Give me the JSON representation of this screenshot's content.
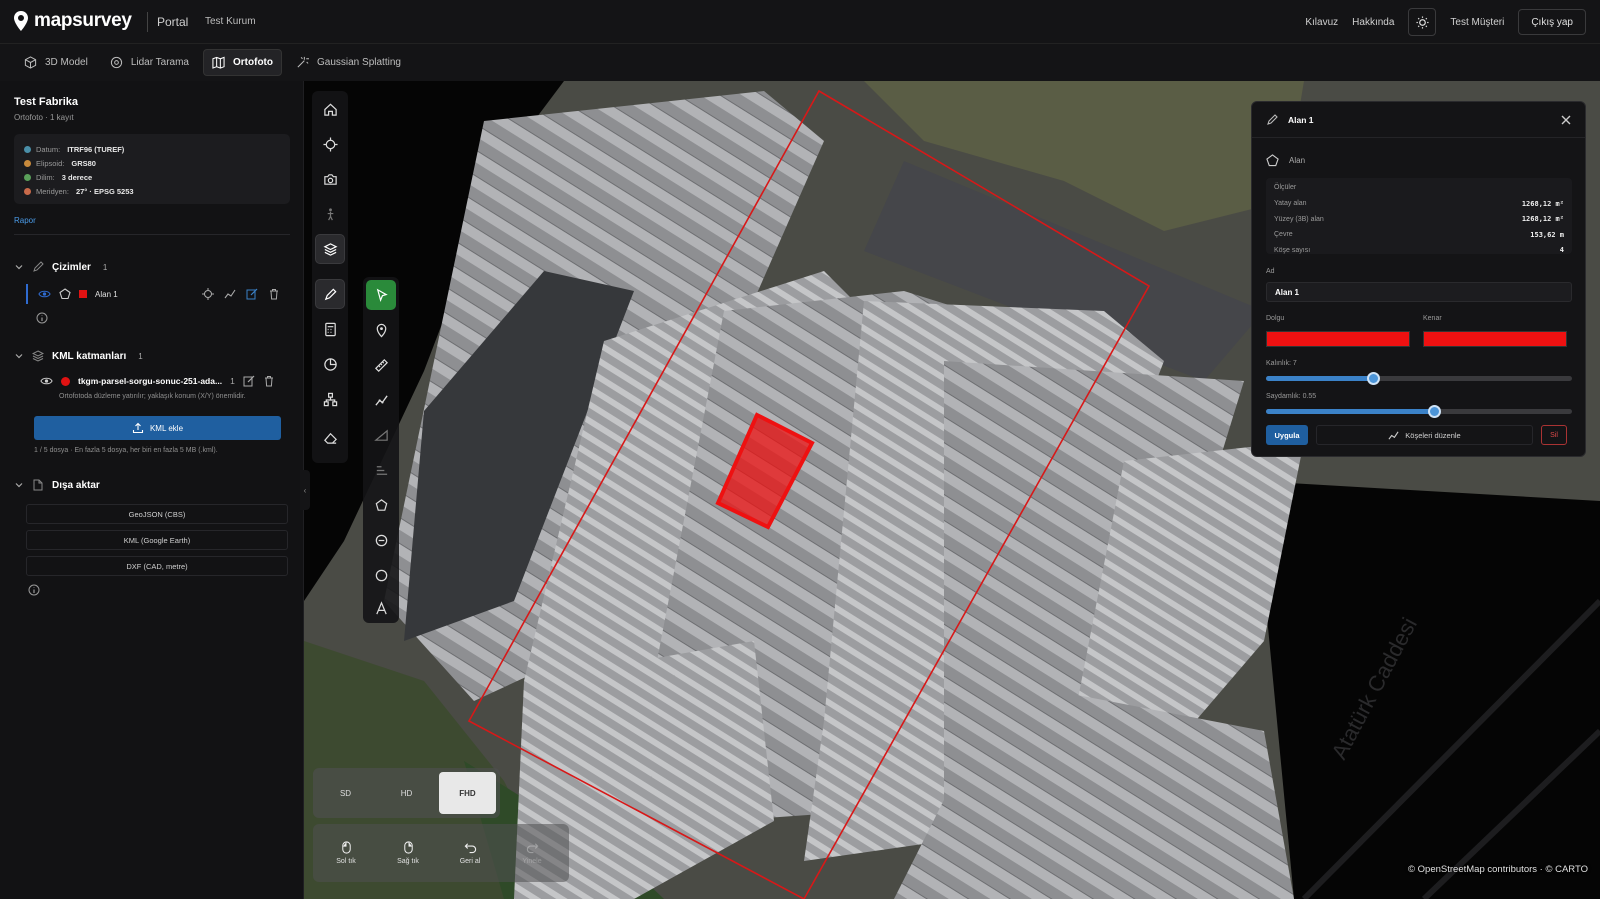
{
  "header": {
    "logo": "mapsurvey",
    "portal": "Portal",
    "organization": "Test Kurum",
    "nav": [
      "Kılavuz",
      "Hakkında"
    ],
    "user": "Test Müşteri",
    "logout": "Çıkış yap"
  },
  "tabs": [
    {
      "label": "3D Model",
      "icon": "cube-icon"
    },
    {
      "label": "Lidar Tarama",
      "icon": "scan-icon"
    },
    {
      "label": "Ortofoto",
      "icon": "map-icon",
      "active": true
    },
    {
      "label": "Gaussian Splatting",
      "icon": "sparkle-icon"
    }
  ],
  "sidebar": {
    "project_title": "Test Fabrika",
    "project_subtitle": "Ortofoto · 1 kayıt",
    "info": [
      {
        "label": "Datum:",
        "value": "ITRF96 (TUREF)"
      },
      {
        "label": "Elipsoid:",
        "value": "GRS80"
      },
      {
        "label": "Dilim:",
        "value": "3 derece"
      },
      {
        "label": "Meridyen:",
        "value": "27° · EPSG 5253"
      }
    ],
    "report_link": "Rapor",
    "drawings": {
      "title": "Çizimler",
      "count": "1",
      "item": "Alan 1"
    },
    "kml": {
      "title": "KML katmanları",
      "count": "1",
      "file": "tkgm-parsel-sorgu-sonuc-251-ada...",
      "file_count": "1",
      "note": "Ortofotoda düzleme yatırılır; yaklaşık konum (X/Y) önemlidir.",
      "add_button": "KML ekle",
      "limit": "1 / 5 dosya · En fazla 5 dosya, her biri en fazla 5 MB (.kml)."
    },
    "export": {
      "title": "Dışa aktar",
      "options": [
        "GeoJSON (CBS)",
        "KML (Google Earth)",
        "DXF (CAD, metre)"
      ]
    }
  },
  "map_controls": {
    "resolutions": [
      "SD",
      "HD",
      "FHD"
    ],
    "active_resolution": "FHD",
    "controls": [
      "Sol tık",
      "Sağ tık",
      "Geri al",
      "Yinele"
    ],
    "attribution": "© OpenStreetMap contributors · © CARTO",
    "street_label": "Atatürk Caddesi"
  },
  "panel": {
    "title": "Alan 1",
    "type": "Alan",
    "measurements_title": "Ölçüler",
    "measurements": [
      {
        "label": "Yatay alan",
        "value": "1268,12 m²"
      },
      {
        "label": "Yüzey (3B) alan",
        "value": "1268,12 m²"
      },
      {
        "label": "Çevre",
        "value": "153,62 m"
      },
      {
        "label": "Köşe sayısı",
        "value": "4"
      }
    ],
    "name_label": "Ad",
    "name_value": "Alan 1",
    "fill_label": "Dolgu",
    "edge_label": "Kenar",
    "fill_color": "#ee1111",
    "edge_color": "#ee1111",
    "thickness_label": "Kalınlık: 7",
    "thickness": 7,
    "opacity_label": "Saydamlık: 0.55",
    "opacity": 0.55,
    "apply": "Uygula",
    "edit_vertices": "Köşeleri düzenle",
    "delete": "Sil"
  }
}
